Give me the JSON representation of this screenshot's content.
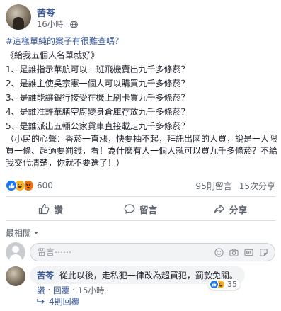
{
  "post": {
    "author": "苦苓",
    "time": "16小時",
    "hashtag": "#這樣單純的案子有很難查嗎？",
    "intro": "《給我五個人名單就好》",
    "questions": [
      "1、是誰指示華航可以一班飛機賣出九千多條菸？",
      "2、是誰主使吳宗憲一個人可以購買九千多條菸？",
      "3、是誰能讓銀行接受在機上刷卡買九千多條菸？",
      "4、是誰准許華膳空廚變身倉庫存放九千多條菸？",
      "5、是誰派出五輛公家貨車直接載走九千多條菸？"
    ],
    "note": "（小民的心聲：香菸一直漲，快要抽不起，拜託出國的人買，說是一人限買一條、超過要罰錢，看！為什麼有人一個人就可以買九千多條菸？不給我交代清楚，你就不要選了！）"
  },
  "stats": {
    "reaction_count": "600",
    "comments": "95則留言",
    "shares": "15次分享"
  },
  "actions": {
    "like": "讚",
    "comment": "留言",
    "share": "分享"
  },
  "sort": {
    "label": "最相關"
  },
  "comment_input": {
    "placeholder": "留言⋯⋯"
  },
  "comment": {
    "author": "苦苓",
    "text": "從此以後，走私犯一律改為超買犯，罰款免關。",
    "react_count": "35",
    "like": "讚",
    "reply": "回覆",
    "time": "15小時",
    "separator": "·",
    "replies": "4則回覆"
  },
  "colors": {
    "link": "#385898",
    "secondary_text": "#606770",
    "like_blue": "#1877f2",
    "haha_yellow": "#f7b125",
    "angry_orange": "#e9710f"
  }
}
